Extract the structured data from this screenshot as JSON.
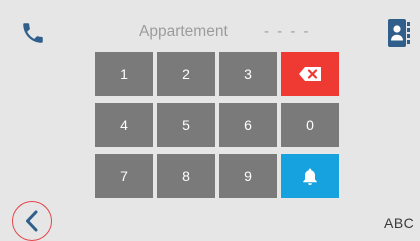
{
  "header": {
    "title_label": "Appartement",
    "title_value": "- - - -",
    "phone_icon": "phone-icon",
    "directory_icon": "directory-icon"
  },
  "keypad": {
    "keys": [
      "1",
      "2",
      "3",
      "4",
      "5",
      "6",
      "0",
      "7",
      "8",
      "9"
    ],
    "erase_icon": "backspace-icon",
    "call_icon": "bell-icon"
  },
  "footer": {
    "back_icon": "chevron-left-icon",
    "abc_label": "ABC"
  },
  "colors": {
    "background": "#e6e6e6",
    "key": "#7a7a7a",
    "erase": "#ee3a33",
    "call": "#15a2df",
    "accent": "#2f5f8a",
    "back_ring": "#e5444a"
  }
}
